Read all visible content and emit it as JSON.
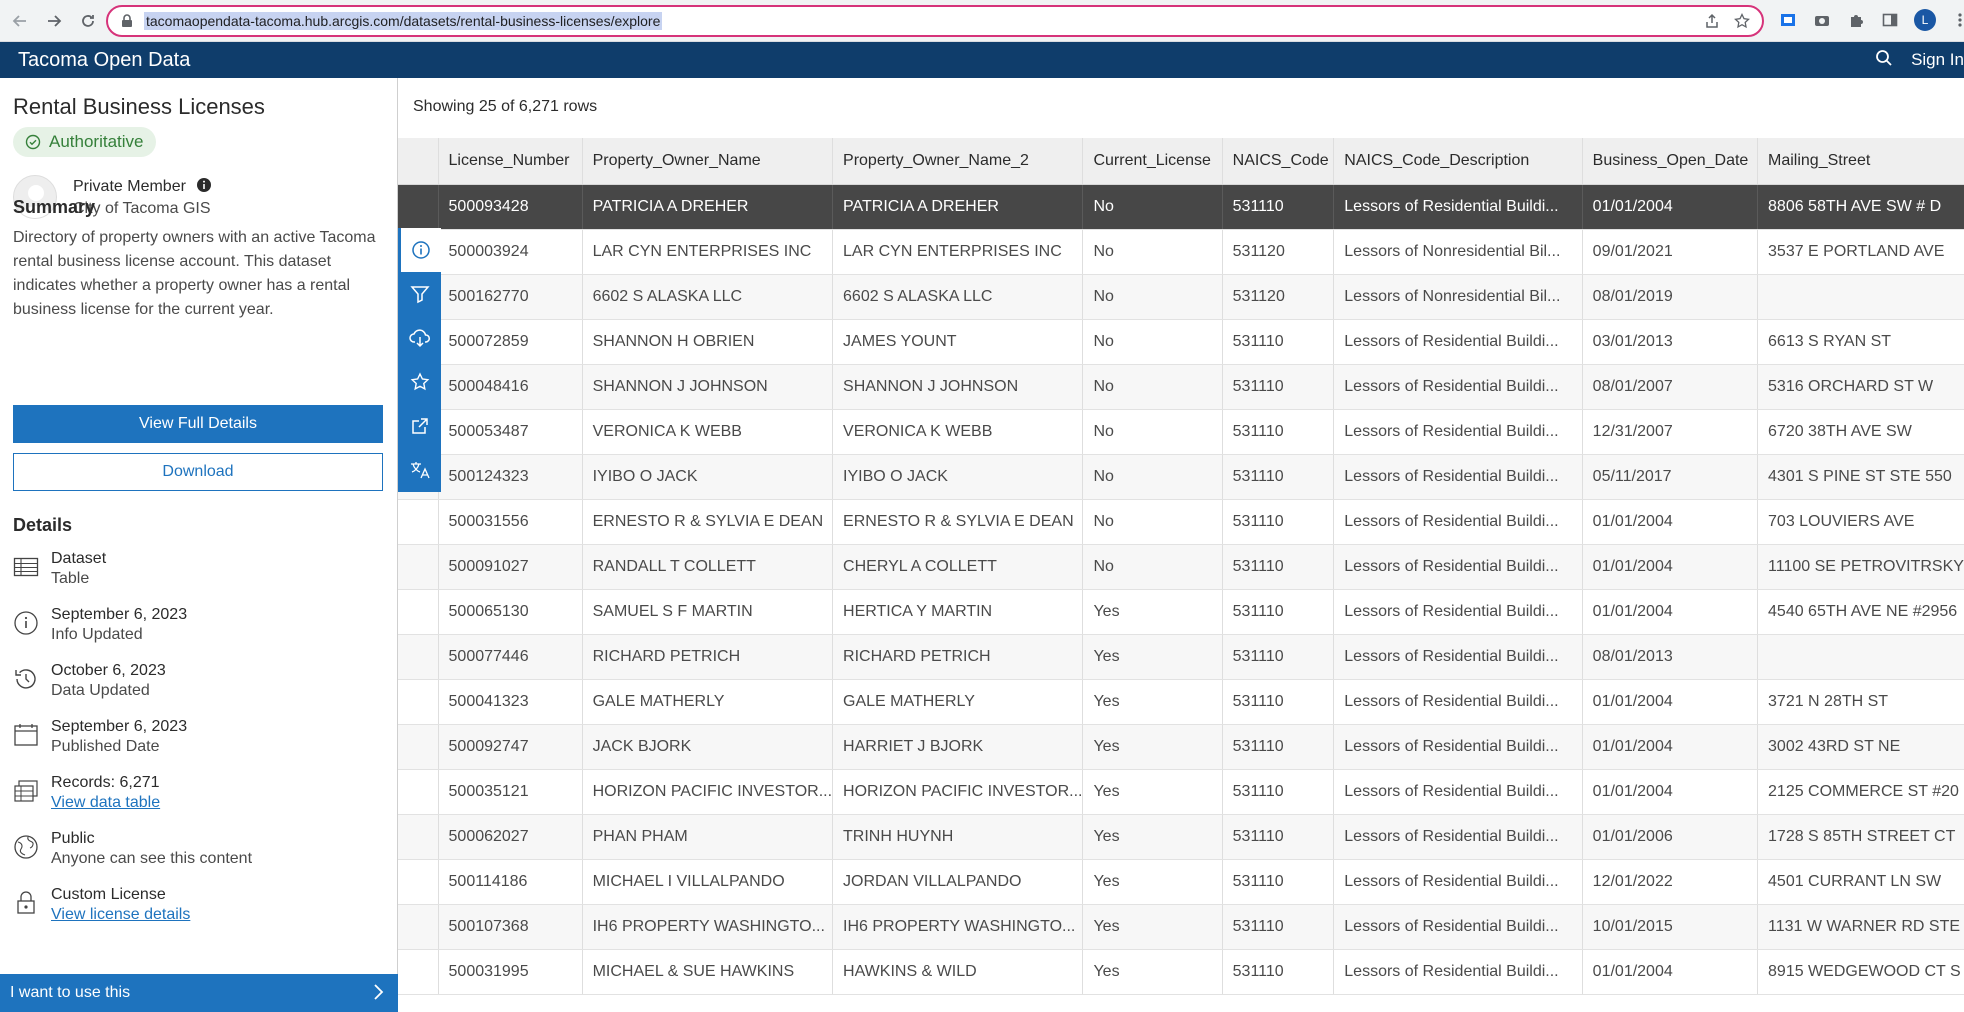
{
  "browser": {
    "url": "tacomaopendata-tacoma.hub.arcgis.com/datasets/rental-business-licenses/explore",
    "profile_initial": "L"
  },
  "header": {
    "site_title": "Tacoma Open Data",
    "sign_in": "Sign In"
  },
  "sidebar": {
    "title": "Rental Business Licenses",
    "badge": "Authoritative",
    "owner_name": "Private Member",
    "owner_org": "City of Tacoma GIS",
    "summary_heading": "Summary",
    "summary_text": "Directory of property owners with an active Tacoma rental business license account. This dataset indicates whether a property owner has a rental business license for the current year.",
    "view_details": "View Full Details",
    "download": "Download",
    "details_heading": "Details",
    "details": [
      {
        "icon": "table-icon",
        "main": "Dataset",
        "sub": "Table"
      },
      {
        "icon": "info-icon",
        "main": "September 6, 2023",
        "sub": "Info Updated"
      },
      {
        "icon": "history-icon",
        "main": "October 6, 2023",
        "sub": "Data Updated"
      },
      {
        "icon": "calendar-icon",
        "main": "September 6, 2023",
        "sub": "Published Date"
      },
      {
        "icon": "records-icon",
        "main": "Records: 6,271",
        "link": "View data table"
      },
      {
        "icon": "globe-icon",
        "main": "Public",
        "sub": "Anyone can see this content"
      },
      {
        "icon": "lock-icon",
        "main": "Custom License",
        "link": "View license details"
      }
    ],
    "use_bar": "I want to use this"
  },
  "main": {
    "showing": "Showing 25 of 6,271 rows",
    "columns": [
      "License_Number",
      "Property_Owner_Name",
      "Property_Owner_Name_2",
      "Current_License",
      "NAICS_Code",
      "NAICS_Code_Description",
      "Business_Open_Date",
      "Mailing_Street"
    ],
    "rows": [
      [
        "500093428",
        "PATRICIA A DREHER",
        "PATRICIA A DREHER",
        "No",
        "531110",
        "Lessors of Residential Buildi...",
        "01/01/2004",
        "8806 58TH AVE SW # D"
      ],
      [
        "500003924",
        "LAR CYN ENTERPRISES INC",
        "LAR CYN ENTERPRISES INC",
        "No",
        "531120",
        "Lessors of Nonresidential Bil...",
        "09/01/2021",
        "3537 E PORTLAND AVE"
      ],
      [
        "500162770",
        "6602 S ALASKA LLC",
        "6602 S ALASKA LLC",
        "No",
        "531120",
        "Lessors of Nonresidential Bil...",
        "08/01/2019",
        ""
      ],
      [
        "500072859",
        "SHANNON H OBRIEN",
        "JAMES YOUNT",
        "No",
        "531110",
        "Lessors of Residential Buildi...",
        "03/01/2013",
        "6613 S RYAN ST"
      ],
      [
        "500048416",
        "SHANNON J JOHNSON",
        "SHANNON J JOHNSON",
        "No",
        "531110",
        "Lessors of Residential Buildi...",
        "08/01/2007",
        "5316 ORCHARD ST W"
      ],
      [
        "500053487",
        "VERONICA K WEBB",
        "VERONICA K WEBB",
        "No",
        "531110",
        "Lessors of Residential Buildi...",
        "12/31/2007",
        "6720 38TH AVE SW"
      ],
      [
        "500124323",
        "IYIBO O JACK",
        "IYIBO O JACK",
        "No",
        "531110",
        "Lessors of Residential Buildi...",
        "05/11/2017",
        "4301 S PINE ST STE 550"
      ],
      [
        "500031556",
        "ERNESTO R & SYLVIA E DEAN",
        "ERNESTO R & SYLVIA E DEAN",
        "No",
        "531110",
        "Lessors of Residential Buildi...",
        "01/01/2004",
        "703 LOUVIERS AVE"
      ],
      [
        "500091027",
        "RANDALL T COLLETT",
        "CHERYL A COLLETT",
        "No",
        "531110",
        "Lessors of Residential Buildi...",
        "01/01/2004",
        "11100 SE PETROVITRSKY"
      ],
      [
        "500065130",
        "SAMUEL S F MARTIN",
        "HERTICA Y MARTIN",
        "Yes",
        "531110",
        "Lessors of Residential Buildi...",
        "01/01/2004",
        "4540 65TH AVE NE #2956"
      ],
      [
        "500077446",
        "RICHARD PETRICH",
        "RICHARD PETRICH",
        "Yes",
        "531110",
        "Lessors of Residential Buildi...",
        "08/01/2013",
        ""
      ],
      [
        "500041323",
        "GALE MATHERLY",
        "GALE MATHERLY",
        "Yes",
        "531110",
        "Lessors of Residential Buildi...",
        "01/01/2004",
        "3721 N 28TH ST"
      ],
      [
        "500092747",
        "JACK BJORK",
        "HARRIET J BJORK",
        "Yes",
        "531110",
        "Lessors of Residential Buildi...",
        "01/01/2004",
        "3002 43RD ST NE"
      ],
      [
        "500035121",
        "HORIZON PACIFIC INVESTOR...",
        "HORIZON PACIFIC INVESTOR...",
        "Yes",
        "531110",
        "Lessors of Residential Buildi...",
        "01/01/2004",
        "2125 COMMERCE ST #20"
      ],
      [
        "500062027",
        "PHAN PHAM",
        "TRINH HUYNH",
        "Yes",
        "531110",
        "Lessors of Residential Buildi...",
        "01/01/2006",
        "1728 S 85TH STREET CT"
      ],
      [
        "500114186",
        "MICHAEL I VILLALPANDO",
        "JORDAN VILLALPANDO",
        "Yes",
        "531110",
        "Lessors of Residential Buildi...",
        "12/01/2022",
        "4501 CURRANT LN SW"
      ],
      [
        "500107368",
        "IH6 PROPERTY WASHINGTO...",
        "IH6 PROPERTY WASHINGTO...",
        "Yes",
        "531110",
        "Lessors of Residential Buildi...",
        "10/01/2015",
        "1131 W WARNER RD STE"
      ],
      [
        "500031995",
        "MICHAEL & SUE HAWKINS",
        "HAWKINS & WILD",
        "Yes",
        "531110",
        "Lessors of Residential Buildi...",
        "01/01/2004",
        "8915 WEDGEWOOD CT S"
      ]
    ],
    "tools": [
      "info-icon",
      "filter-icon",
      "cloud-download-icon",
      "star-icon",
      "share-icon",
      "translate-icon"
    ]
  },
  "colors": {
    "header": "#0f3d6b",
    "accent": "#1e73be",
    "selected_row": "#474747",
    "badge_green": "#35803a"
  }
}
